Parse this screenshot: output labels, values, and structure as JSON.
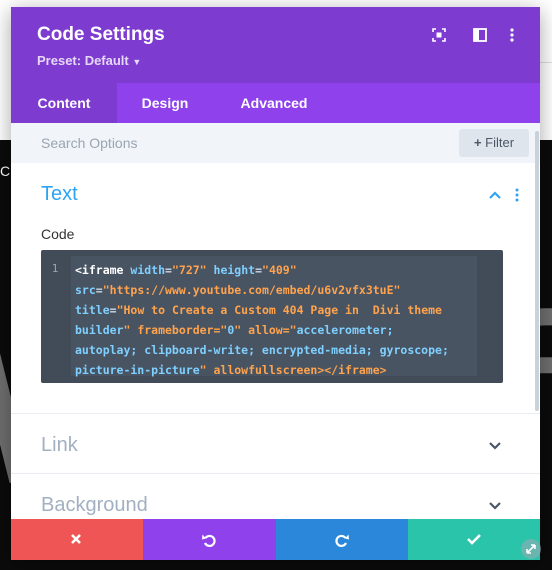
{
  "modal": {
    "title": "Code Settings",
    "preset": "Preset: Default",
    "header_icons": [
      "focus-icon",
      "split-view-icon",
      "more-vertical-icon"
    ]
  },
  "tabs": [
    {
      "label": "Content",
      "active": true
    },
    {
      "label": "Design",
      "active": false
    },
    {
      "label": "Advanced",
      "active": false
    }
  ],
  "search": {
    "placeholder": "Search Options",
    "filter_label": "Filter"
  },
  "sections": [
    {
      "title": "Text",
      "open": true
    },
    {
      "title": "Link",
      "open": false
    },
    {
      "title": "Background",
      "open": false
    }
  ],
  "code_field": {
    "label": "Code",
    "line_number": "1",
    "lines": [
      "<iframe width=\"727\" height=\"409\"",
      "src=\"https://www.youtube.com/embed/u6v2vfx3tuE\"",
      "title=\"How to Create a Custom 404 Page in  Divi theme",
      "builder\" frameborder=\"0\" allow=\"accelerometer;",
      "autoplay; clipboard-write; encrypted-media; gyroscope;",
      "picture-in-picture\" allowfullscreen></iframe>"
    ]
  },
  "footer": {
    "buttons": [
      "cancel-icon",
      "undo-icon",
      "redo-icon",
      "save-check-icon"
    ]
  },
  "colors": {
    "header": "#7e3bd0",
    "tabs": "#8f42ec",
    "accent_blue": "#2ea3f2",
    "cancel": "#ef5555",
    "undo": "#8f42ec",
    "redo": "#2b87da",
    "save": "#29c4a9"
  },
  "background_page": {
    "visible_text": "Cu"
  }
}
